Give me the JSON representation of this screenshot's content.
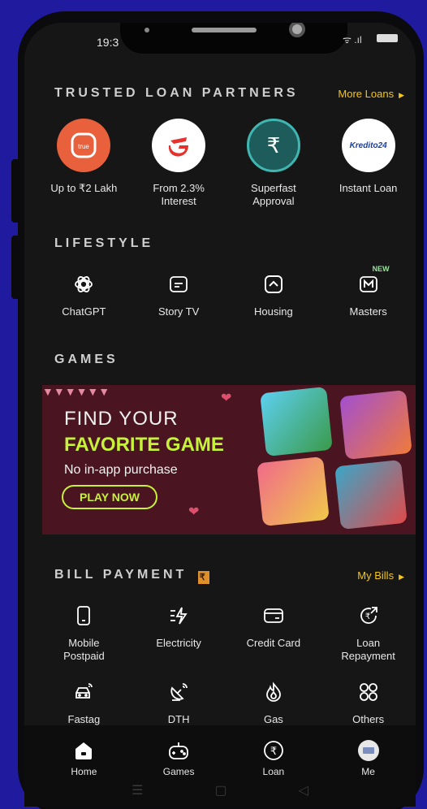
{
  "status": {
    "time": "19:3"
  },
  "loans": {
    "title": "TRUSTED LOAN PARTNERS",
    "more": "More Loans",
    "items": [
      {
        "label": "Up to ₹2 Lakh",
        "icon": "truebalance-logo",
        "color": "#e8613c"
      },
      {
        "label": "From 2.3%\nInterest",
        "icon": "fibe-logo",
        "color": "#ffffff"
      },
      {
        "label": "Superfast\nApproval",
        "icon": "rupee-logo",
        "color": "#1e5c5c"
      },
      {
        "label": "Instant Loan",
        "icon": "kredito24-logo",
        "logo_text": "Kredito24",
        "color": "#ffffff"
      }
    ]
  },
  "lifestyle": {
    "title": "LIFESTYLE",
    "items": [
      {
        "label": "ChatGPT",
        "icon": "chatgpt-icon"
      },
      {
        "label": "Story TV",
        "icon": "story-tv-icon"
      },
      {
        "label": "Housing",
        "icon": "housing-icon"
      },
      {
        "label": "Masters",
        "icon": "masters-icon",
        "badge": "NEW"
      }
    ]
  },
  "games": {
    "title": "GAMES",
    "banner": {
      "line1": "FIND YOUR",
      "line2": "FAVORITE GAME",
      "line3": "No in-app purchase",
      "cta": "PLAY NOW"
    }
  },
  "bills": {
    "title": "BILL PAYMENT",
    "more": "My Bills",
    "items": [
      {
        "label": "Mobile\nPostpaid",
        "icon": "mobile-icon"
      },
      {
        "label": "Electricity",
        "icon": "electricity-icon"
      },
      {
        "label": "Credit Card",
        "icon": "credit-card-icon"
      },
      {
        "label": "Loan\nRepayment",
        "icon": "loan-repayment-icon"
      },
      {
        "label": "Fastag",
        "icon": "car-icon"
      },
      {
        "label": "DTH",
        "icon": "dish-icon"
      },
      {
        "label": "Gas",
        "icon": "flame-icon"
      },
      {
        "label": "Others",
        "icon": "grid-icon"
      }
    ]
  },
  "nav": {
    "items": [
      {
        "label": "Home",
        "icon": "home-icon"
      },
      {
        "label": "Games",
        "icon": "gamepad-icon"
      },
      {
        "label": "Loan",
        "icon": "rupee-circle-icon"
      },
      {
        "label": "Me",
        "icon": "avatar-icon"
      }
    ]
  },
  "colors": {
    "accent": "#f5c518",
    "lime": "#c6f23a",
    "background": "#1f1a9e",
    "screen": "#161616"
  }
}
